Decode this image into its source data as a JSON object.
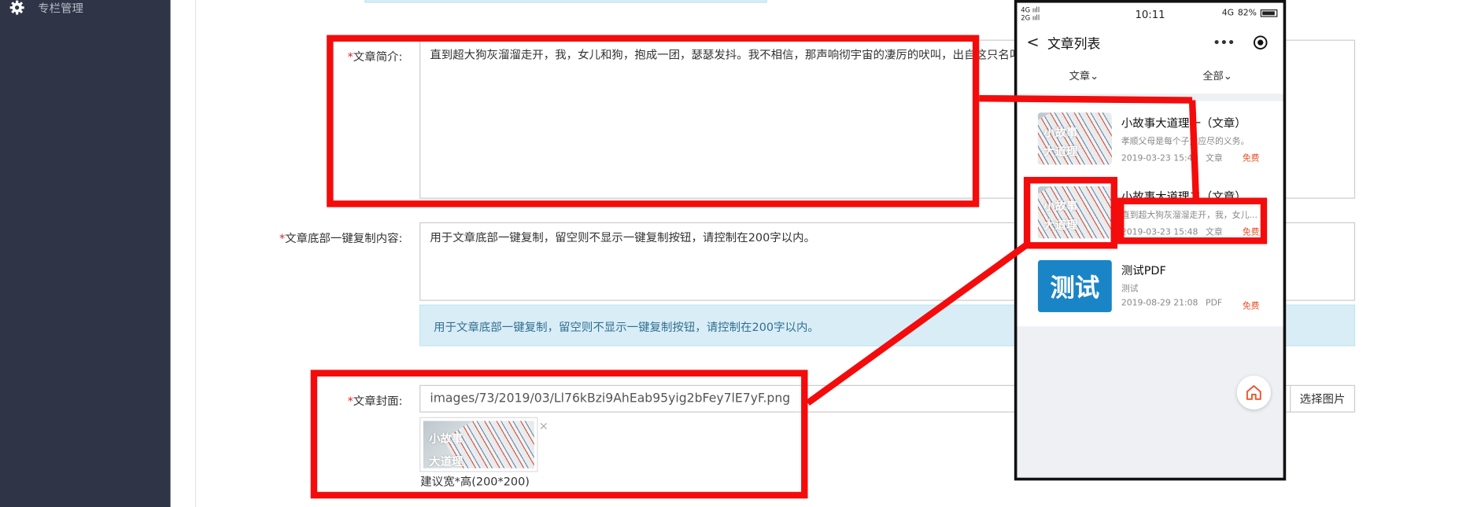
{
  "sidebar": {
    "items": [
      {
        "label": "专栏管理",
        "icon": "gear-icon"
      }
    ]
  },
  "form": {
    "summary": {
      "required": "*",
      "label": "文章简介:",
      "value": "直到超大狗灰溜溜走开，我，女儿和狗，抱成一团，瑟瑟发抖。我不相信，那声响彻宇宙的凄厉的吠叫，出自这只名叫阿"
    },
    "copy": {
      "required": "*",
      "label": "文章底部一键复制内容:",
      "value": "用于文章底部一键复制，留空则不显示一键复制按钮，请控制在200字以内。",
      "hint": "用于文章底部一键复制，留空则不显示一键复制按钮，请控制在200字以内。"
    },
    "cover": {
      "required": "*",
      "label": "文章封面:",
      "value": "images/73/2019/03/Ll76kBzi9AhEab95yig2bFey7lE7yF.png",
      "button": "选择图片",
      "remove": "×",
      "size_note": "建议宽*高(200*200)",
      "thumb_text": [
        "小故事",
        "大道理"
      ]
    }
  },
  "phone": {
    "status": {
      "net_top": "4G ııll",
      "net_bottom": "2G ııll",
      "time": "10:11",
      "battery": "82%",
      "signal": "4G"
    },
    "nav": {
      "back": "<",
      "title": "文章列表",
      "more": "•••"
    },
    "filters": [
      {
        "label": "文章",
        "arrow": "⌄"
      },
      {
        "label": "全部",
        "arrow": "⌄"
      }
    ],
    "items": [
      {
        "title": "小故事大道理一（文章）",
        "desc": "孝顺父母是每个子女应尽的义务。",
        "date": "2019-03-23 15:45",
        "type": "文章",
        "fee": "免费",
        "thumb": [
          "小故事",
          "大道理"
        ]
      },
      {
        "title": "小故事大道理二（文章）",
        "desc": "直到超大狗灰溜溜走开，我，女儿和狗，抱成一团",
        "date": "2019-03-23 15:48",
        "type": "文章",
        "fee": "免费",
        "thumb": [
          "小故事",
          "大道理"
        ]
      },
      {
        "title": "测试PDF",
        "desc": "测试",
        "date": "2019-08-29 21:08",
        "type": "PDF",
        "fee": "免费",
        "thumb": [
          "测试"
        ]
      }
    ]
  },
  "colors": {
    "sidebar": "#2f3447",
    "annotation": "#f40c0c",
    "hint_bg": "#d9edf7",
    "fee": "#e8552e",
    "pdf_thumb": "#1a85c6"
  }
}
